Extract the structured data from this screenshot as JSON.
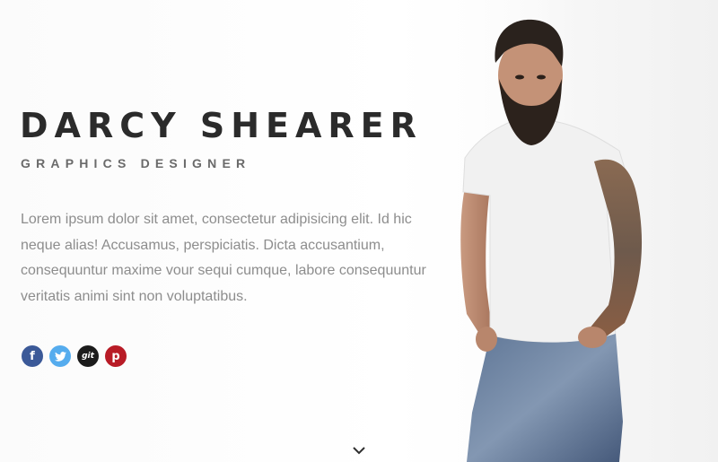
{
  "nav": {
    "menu_icon": "hamburger-icon"
  },
  "hero": {
    "name": "DARCY SHEARER",
    "role": "GRAPHICS DESIGNER",
    "bio": "Lorem ipsum dolor sit amet, consectetur adipisicing elit. Id hic neque alias! Accusamus, perspiciatis. Dicta accusantium, consequuntur maxime vour sequi cumque, labore consequuntur veritatis animi sint non voluptatibus."
  },
  "social": [
    {
      "icon": "facebook-icon",
      "glyph": "f",
      "color": "#3b5998"
    },
    {
      "icon": "twitter-icon",
      "glyph": "",
      "color": "#55acee"
    },
    {
      "icon": "github-icon",
      "glyph": "git",
      "color": "#1b1b1b"
    },
    {
      "icon": "pinterest-icon",
      "glyph": "p",
      "color": "#b81b26"
    }
  ],
  "scroll": {
    "icon": "chevron-down-icon"
  },
  "colors": {
    "text_dark": "#2b2b2b",
    "text_muted": "#8d8d8d",
    "background": "#ffffff"
  }
}
